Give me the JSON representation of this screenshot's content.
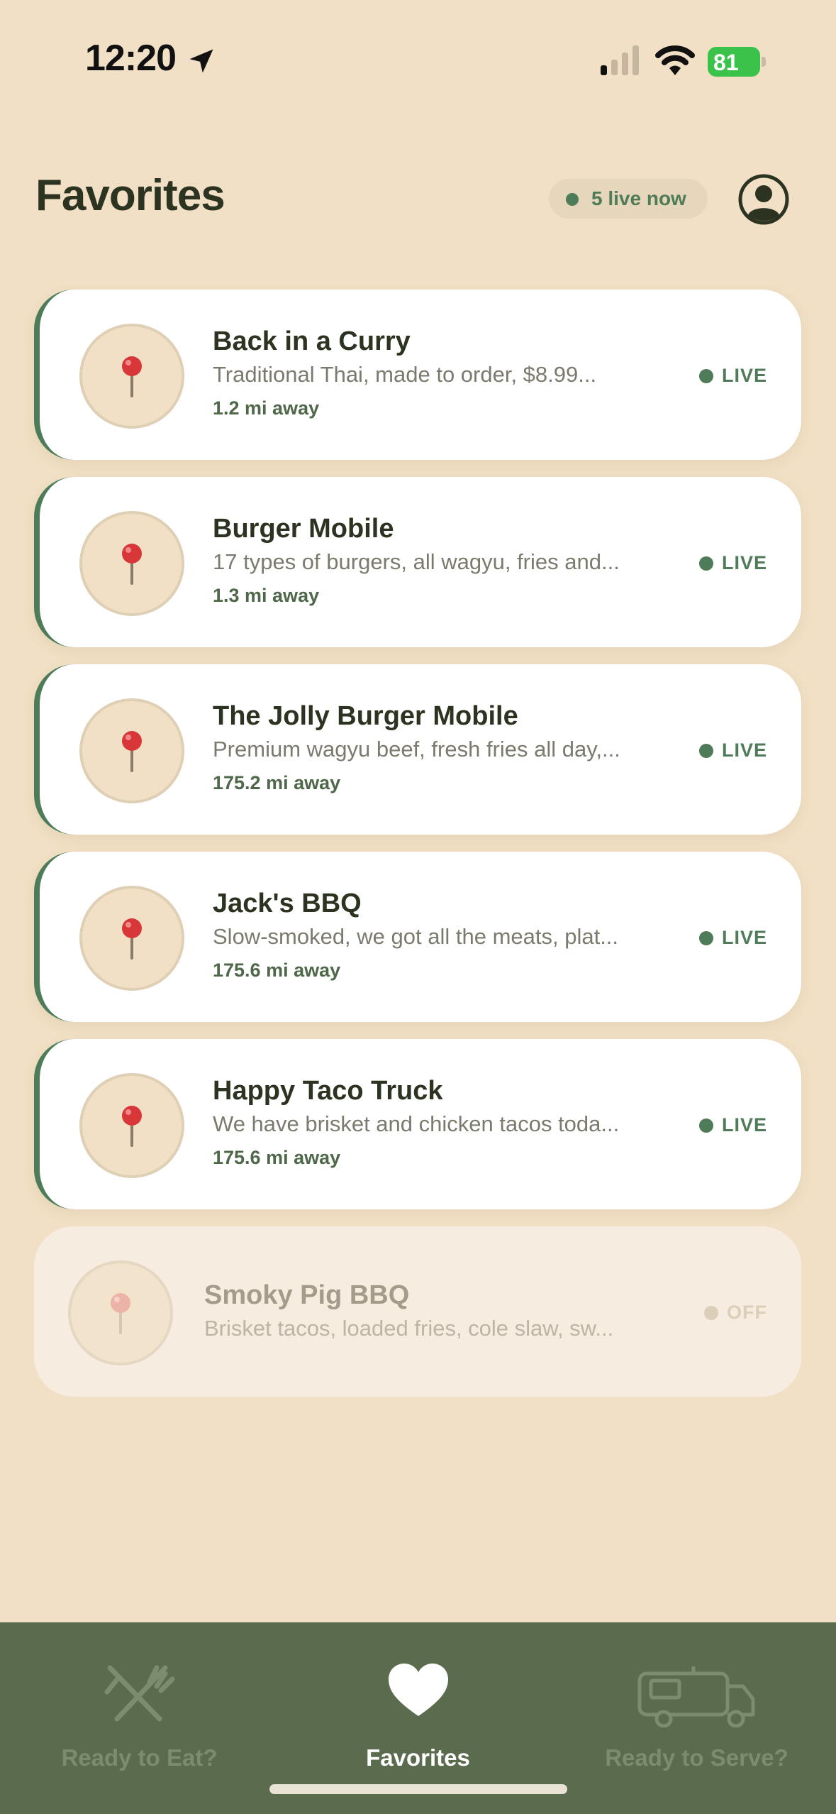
{
  "status_bar": {
    "time": "12:20",
    "battery": "81"
  },
  "header": {
    "title": "Favorites",
    "live_count": "5 live now"
  },
  "colors": {
    "accent": "#4f7c58",
    "background": "#f1e0c5",
    "tab_bar": "#5a6b4e"
  },
  "favorites": [
    {
      "name": "Back in a Curry",
      "description": "Traditional Thai, made to order, $8.99...",
      "distance": "1.2 mi away",
      "status": "LIVE"
    },
    {
      "name": "Burger Mobile",
      "description": "17 types of burgers, all wagyu, fries and...",
      "distance": "1.3 mi away",
      "status": "LIVE"
    },
    {
      "name": "The Jolly Burger Mobile",
      "description": "Premium wagyu beef, fresh fries all day,...",
      "distance": "175.2 mi away",
      "status": "LIVE"
    },
    {
      "name": "Jack's BBQ",
      "description": "Slow-smoked, we got all the meats, plat...",
      "distance": "175.6 mi away",
      "status": "LIVE"
    },
    {
      "name": "Happy Taco Truck",
      "description": "We have brisket and chicken tacos toda...",
      "distance": "175.6 mi away",
      "status": "LIVE"
    },
    {
      "name": "Smoky Pig BBQ",
      "description": "Brisket tacos, loaded fries, cole slaw, sw...",
      "distance": "",
      "status": "OFF"
    }
  ],
  "tabs": [
    {
      "label": "Ready to Eat?",
      "icon": "fork-knife-icon"
    },
    {
      "label": "Favorites",
      "icon": "heart-icon",
      "active": true
    },
    {
      "label": "Ready to Serve?",
      "icon": "truck-icon"
    }
  ]
}
